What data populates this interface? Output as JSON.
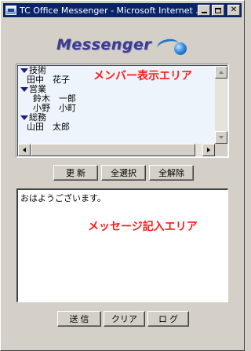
{
  "window": {
    "title": "TC Office Messenger - Microsoft Internet ..."
  },
  "logo": {
    "text": "Messenger"
  },
  "members": {
    "groups": [
      {
        "name": "技術",
        "members": [
          "田中　花子"
        ]
      },
      {
        "name": "営業",
        "members": [
          "鈴木　一郎",
          "小野　小町"
        ]
      },
      {
        "name": "総務",
        "members": [
          "山田　太郎"
        ]
      }
    ],
    "overlay_label": "メンバー表示エリア"
  },
  "member_buttons": {
    "refresh": "更 新",
    "select_all": "全選択",
    "deselect_all": "全解除"
  },
  "message": {
    "text": "おはようございます。",
    "overlay_label": "メッセージ記入エリア"
  },
  "message_buttons": {
    "send": "送 信",
    "clear": "クリア",
    "log": "ロ グ"
  },
  "colors": {
    "titlebar": "#0a246a",
    "annotation": "#ff1a1a",
    "list_background": "#eef4fb"
  }
}
